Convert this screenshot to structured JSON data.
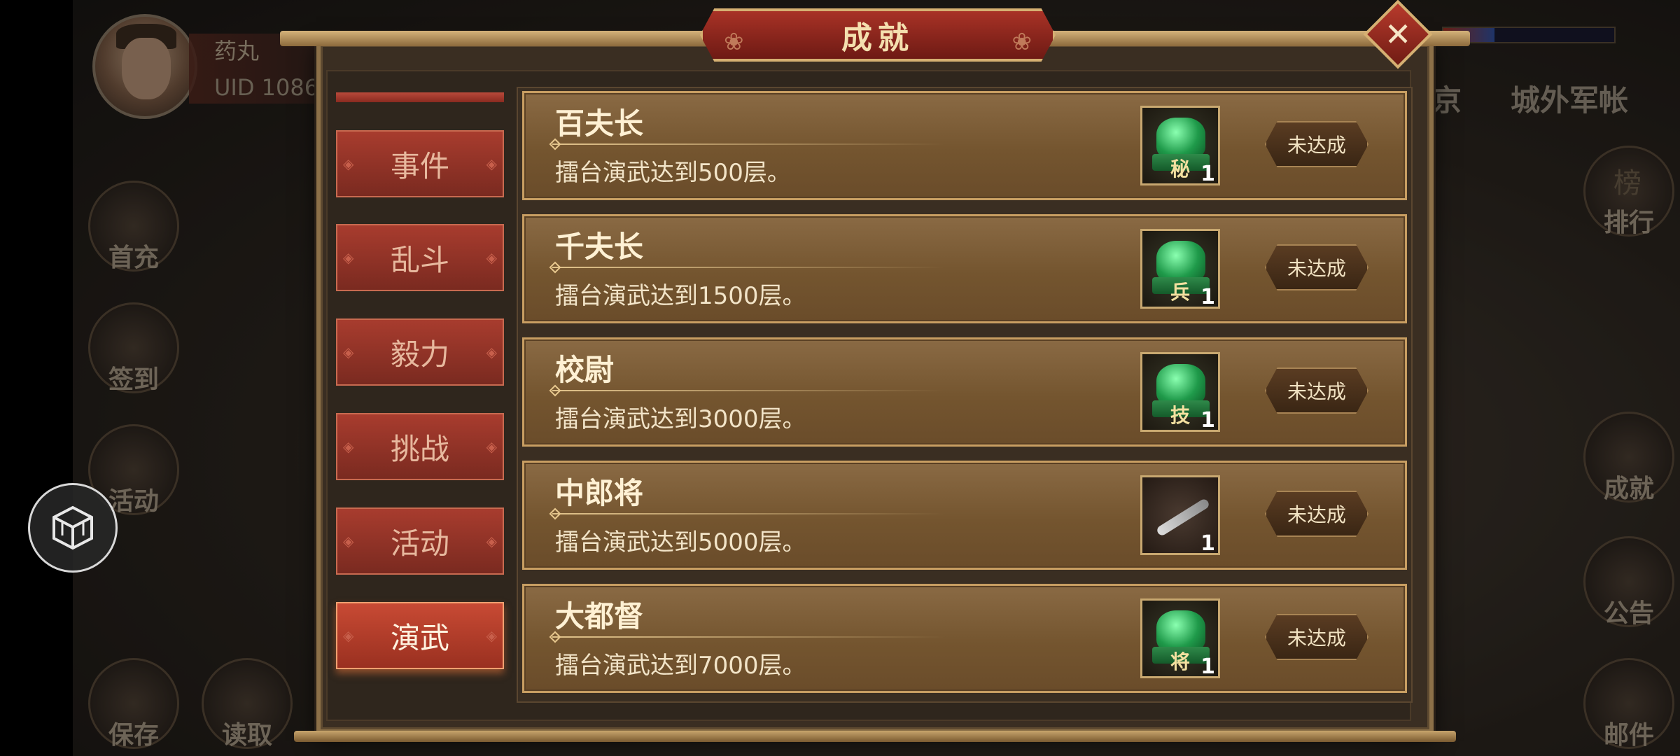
{
  "dialog": {
    "title": "成就",
    "close_label": "✕"
  },
  "player": {
    "name": "药丸",
    "uid": "UID  1086"
  },
  "categories": [
    {
      "label": "事件"
    },
    {
      "label": "乱斗"
    },
    {
      "label": "毅力"
    },
    {
      "label": "挑战"
    },
    {
      "label": "活动"
    },
    {
      "label": "演武",
      "active": true
    }
  ],
  "achievements": [
    {
      "title": "百夫长",
      "desc": "擂台演武达到500层。",
      "reward_char": "秘",
      "reward_qty": "1",
      "status": "未达成"
    },
    {
      "title": "千夫长",
      "desc": "擂台演武达到1500层。",
      "reward_char": "兵",
      "reward_qty": "1",
      "status": "未达成"
    },
    {
      "title": "校尉",
      "desc": "擂台演武达到3000层。",
      "reward_char": "技",
      "reward_qty": "1",
      "status": "未达成"
    },
    {
      "title": "中郎将",
      "desc": "擂台演武达到5000层。",
      "reward_char": "",
      "reward_qty": "1",
      "status": "未达成",
      "reward_icon": "knife-icon"
    },
    {
      "title": "大都督",
      "desc": "擂台演武达到7000层。",
      "reward_char": "将",
      "reward_qty": "1",
      "status": "未达成"
    }
  ],
  "hud": {
    "left_menu": [
      "首充",
      "签到",
      "活动",
      "保存",
      "读取"
    ],
    "right_menu": [
      "排行",
      "成就",
      "公告",
      "邮件"
    ],
    "right_badge": "榜",
    "top_tabs": [
      "京",
      "城外军帐"
    ]
  },
  "colors": {
    "accent": "#a83226",
    "gold": "#c89e62",
    "panel": "#7a5a34"
  }
}
